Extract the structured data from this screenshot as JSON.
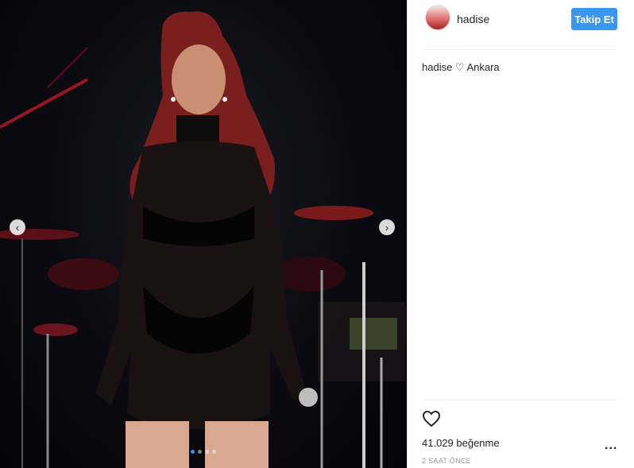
{
  "post": {
    "username": "hadise",
    "follow_label": "Takip Et",
    "caption": "hadise ♡ Ankara",
    "likes": "41.029 beğenme",
    "time": "2 SAAT ÖNCE",
    "more_label": "..."
  },
  "carousel": {
    "prev_icon": "‹",
    "next_icon": "›",
    "slides": 4,
    "active_slide": 1
  },
  "colors": {
    "accent": "#3897f0",
    "stage_light": "#c0182a"
  }
}
